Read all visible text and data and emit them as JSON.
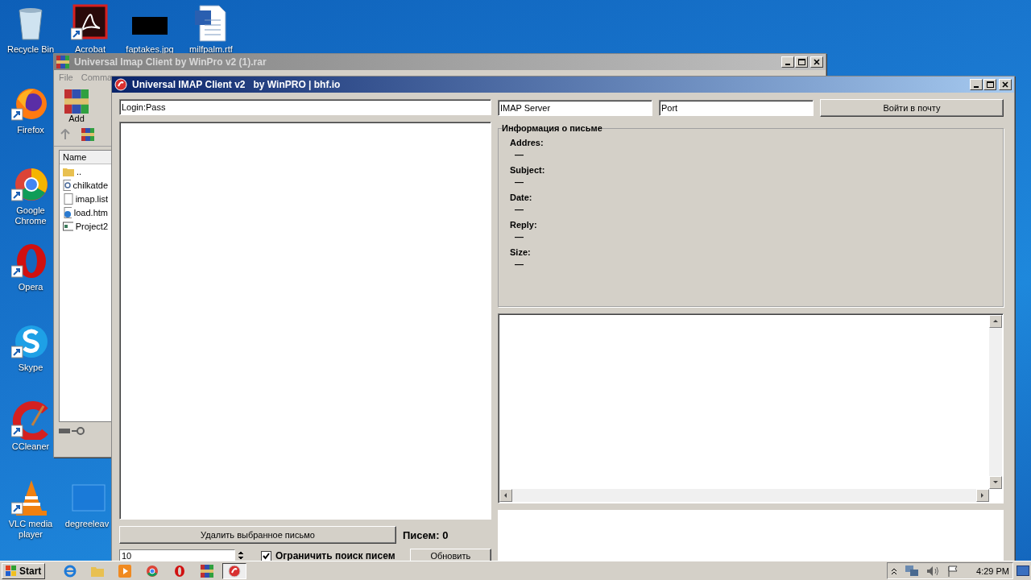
{
  "desktop_icons": [
    {
      "label": "Recycle Bin",
      "kind": "recycle",
      "shortcut": false
    },
    {
      "label": "Acrobat",
      "kind": "acrobat",
      "shortcut": true
    },
    {
      "label": "faptakes.jpg",
      "kind": "image",
      "shortcut": false
    },
    {
      "label": "milfpalm.rtf",
      "kind": "word",
      "shortcut": false
    },
    {
      "label": "Firefox",
      "kind": "firefox",
      "shortcut": true
    },
    {
      "label": "Google Chrome",
      "kind": "chrome",
      "shortcut": true
    },
    {
      "label": "Opera",
      "kind": "opera",
      "shortcut": true
    },
    {
      "label": "Skype",
      "kind": "skype",
      "shortcut": true
    },
    {
      "label": "CCleaner",
      "kind": "ccleaner",
      "shortcut": true
    },
    {
      "label": "VLC media player",
      "kind": "vlc",
      "shortcut": true
    },
    {
      "label": "degreeleav",
      "kind": "blank",
      "shortcut": false
    }
  ],
  "archive_window": {
    "title": "Universal Imap Client by WinPro v2 (1).rar",
    "menu": [
      "File",
      "Comma"
    ],
    "toolbar": [
      "Add"
    ],
    "column": "Name",
    "files": [
      {
        "name": "..",
        "kind": "folder"
      },
      {
        "name": "chilkatde",
        "kind": "library"
      },
      {
        "name": "imap.list",
        "kind": "text"
      },
      {
        "name": "load.htm",
        "kind": "web"
      },
      {
        "name": "Project2",
        "kind": "program"
      }
    ]
  },
  "mail_window": {
    "title": "Universal IMAP Client v2   by WinPRO | bhf.io",
    "login": {
      "value": "Login:Pass"
    },
    "server": {
      "value": "IMAP Server"
    },
    "port": {
      "value": "Port"
    },
    "login_button": "Войти в почту",
    "info": {
      "title": "Информация о письме",
      "fields": [
        {
          "label": "Addres:",
          "value": "—"
        },
        {
          "label": "Subject:",
          "value": "—"
        },
        {
          "label": "Date:",
          "value": "—"
        },
        {
          "label": "Reply:",
          "value": "—"
        },
        {
          "label": "Size:",
          "value": "—"
        }
      ]
    },
    "delete_button": "Удалить выбранное письмо",
    "count": "Писем: 0",
    "limit": {
      "value": "10"
    },
    "limit_checkbox": {
      "label": "Ограничить поиск писем",
      "checked": true
    },
    "refresh_button": "Обновить"
  },
  "taskbar": {
    "start": "Start",
    "apps": [
      {
        "kind": "ie",
        "selected": false
      },
      {
        "kind": "explorer",
        "selected": false
      },
      {
        "kind": "media",
        "selected": false
      },
      {
        "kind": "chrome",
        "selected": false
      },
      {
        "kind": "opera",
        "selected": false
      },
      {
        "kind": "winrar",
        "selected": false
      },
      {
        "kind": "mail",
        "selected": true
      }
    ],
    "tray": [
      {
        "kind": "up"
      },
      {
        "kind": "network"
      },
      {
        "kind": "speaker"
      },
      {
        "kind": "flag"
      }
    ],
    "time": "4:29 PM"
  }
}
